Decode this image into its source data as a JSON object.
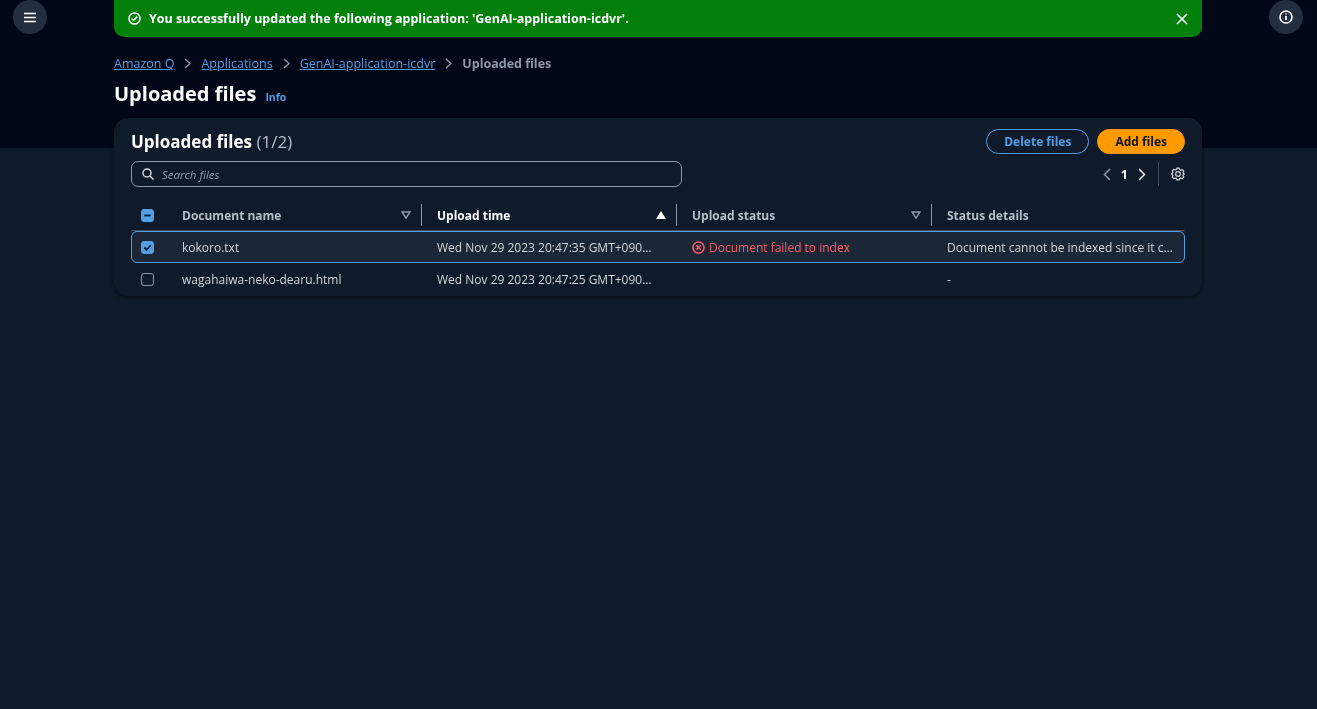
{
  "flash": {
    "kind": "success",
    "message": "You successfully updated the following application: 'GenAI-application-icdvr'."
  },
  "breadcrumbs": [
    {
      "label": "Amazon Q",
      "current": false
    },
    {
      "label": "Applications",
      "current": false
    },
    {
      "label": "GenAI-application-icdvr",
      "current": false
    },
    {
      "label": "Uploaded files",
      "current": true
    }
  ],
  "page": {
    "title": "Uploaded files",
    "info": "Info"
  },
  "table": {
    "title": "Uploaded files",
    "count": "(1/2)",
    "buttons": [
      {
        "label": "Delete files",
        "kind": "normal"
      },
      {
        "label": "Add files",
        "kind": "primary"
      }
    ],
    "search": {
      "placeholder": "Search files"
    },
    "pagination": {
      "page": "1"
    },
    "select_all": {
      "indeterminate": true
    },
    "columns": [
      {
        "label": "Document name",
        "sortable": true,
        "sorted": false
      },
      {
        "label": "Upload time",
        "sortable": true,
        "sorted": true
      },
      {
        "label": "Upload status",
        "sortable": true,
        "sorted": false
      },
      {
        "label": "Status details",
        "sortable": false,
        "sorted": false
      }
    ],
    "rows": [
      {
        "selected": true,
        "name": "kokoro.txt",
        "time": "Wed Nov 29 2023 20:47:35 GMT+090…",
        "status": {
          "kind": "error",
          "text": "Document failed to index"
        },
        "details": "Document cannot be indexed since it c…"
      },
      {
        "selected": false,
        "name": "wagahaiwa-neko-dearu.html",
        "time": "Wed Nov 29 2023 20:47:25 GMT+090…",
        "details": "-"
      }
    ]
  }
}
